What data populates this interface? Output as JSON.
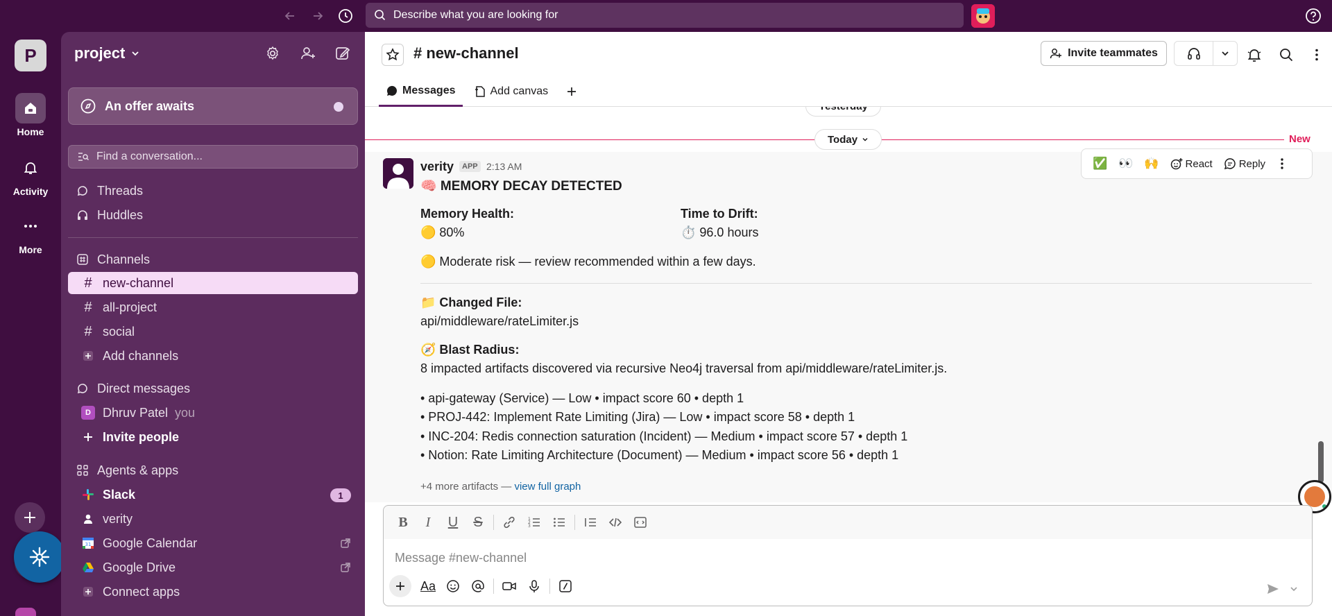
{
  "topbar": {
    "search_placeholder": "Describe what you are looking for"
  },
  "rail": {
    "workspace_initial": "P",
    "items": [
      {
        "label": "Home",
        "icon": "home-icon"
      },
      {
        "label": "Activity",
        "icon": "bell-icon"
      },
      {
        "label": "More",
        "icon": "more-dots-icon"
      }
    ]
  },
  "sidebar": {
    "workspace_name": "project",
    "offer": "An offer awaits",
    "find_placeholder": "Find a conversation...",
    "top_items": [
      {
        "label": "Threads",
        "icon": "threads-icon"
      },
      {
        "label": "Huddles",
        "icon": "headphones-icon"
      }
    ],
    "channels_header": "Channels",
    "channels": [
      {
        "label": "new-channel",
        "active": true
      },
      {
        "label": "all-project",
        "active": false
      },
      {
        "label": "social",
        "active": false
      }
    ],
    "add_channels": "Add channels",
    "dm_header": "Direct messages",
    "dms": [
      {
        "label": "Dhruv Patel",
        "suffix": "you",
        "initial": "D"
      }
    ],
    "invite_people": "Invite people",
    "apps_header": "Agents & apps",
    "apps": [
      {
        "label": "Slack",
        "badge": "1",
        "bold": true
      },
      {
        "label": "verity"
      },
      {
        "label": "Google Calendar"
      },
      {
        "label": "Google Drive"
      }
    ],
    "connect_apps": "Connect apps"
  },
  "channel": {
    "title": "# new-channel",
    "invite_label": "Invite teammates",
    "tabs": [
      {
        "label": "Messages",
        "active": true
      },
      {
        "label": "Add canvas",
        "active": false
      }
    ]
  },
  "messages": {
    "day_prev": "Yesterday",
    "day_today": "Today",
    "new_label": "New",
    "actions": {
      "react": "React",
      "reply": "Reply"
    },
    "message": {
      "author": "verity",
      "tag": "APP",
      "time": "2:13 AM",
      "headline": "🧠 MEMORY DECAY DETECTED",
      "health_label": "Memory Health:",
      "health_value": "🟡 80%",
      "drift_label": "Time to Drift:",
      "drift_value": "⏱️ 96.0 hours",
      "risk": "🟡 Moderate risk — review recommended within a few days.",
      "changed_label": "📁 Changed File:",
      "changed_file": "api/middleware/rateLimiter.js",
      "blast_label": "🧭 Blast Radius:",
      "blast_summary": "8 impacted artifacts discovered via recursive Neo4j traversal from api/middleware/rateLimiter.js.",
      "artifacts": [
        "• api-gateway (Service) — Low • impact score 60 • depth 1",
        "• PROJ-442: Implement Rate Limiting (Jira) — Low • impact score 58 • depth 1",
        "• INC-204: Redis connection saturation (Incident) — Medium • impact score 57 • depth 1",
        "• Notion: Rate Limiting Architecture (Document) — Medium • impact score 56 • depth 1"
      ],
      "more_text": "+4 more artifacts — ",
      "more_link": "view full graph"
    }
  },
  "composer": {
    "placeholder": "Message #new-channel"
  },
  "colors": {
    "aubergine": "#3f0e40",
    "sidebar": "#5c2c5e",
    "active_channel": "#f6dbf6",
    "new_red": "#e01e5a",
    "link_blue": "#1264a3"
  }
}
